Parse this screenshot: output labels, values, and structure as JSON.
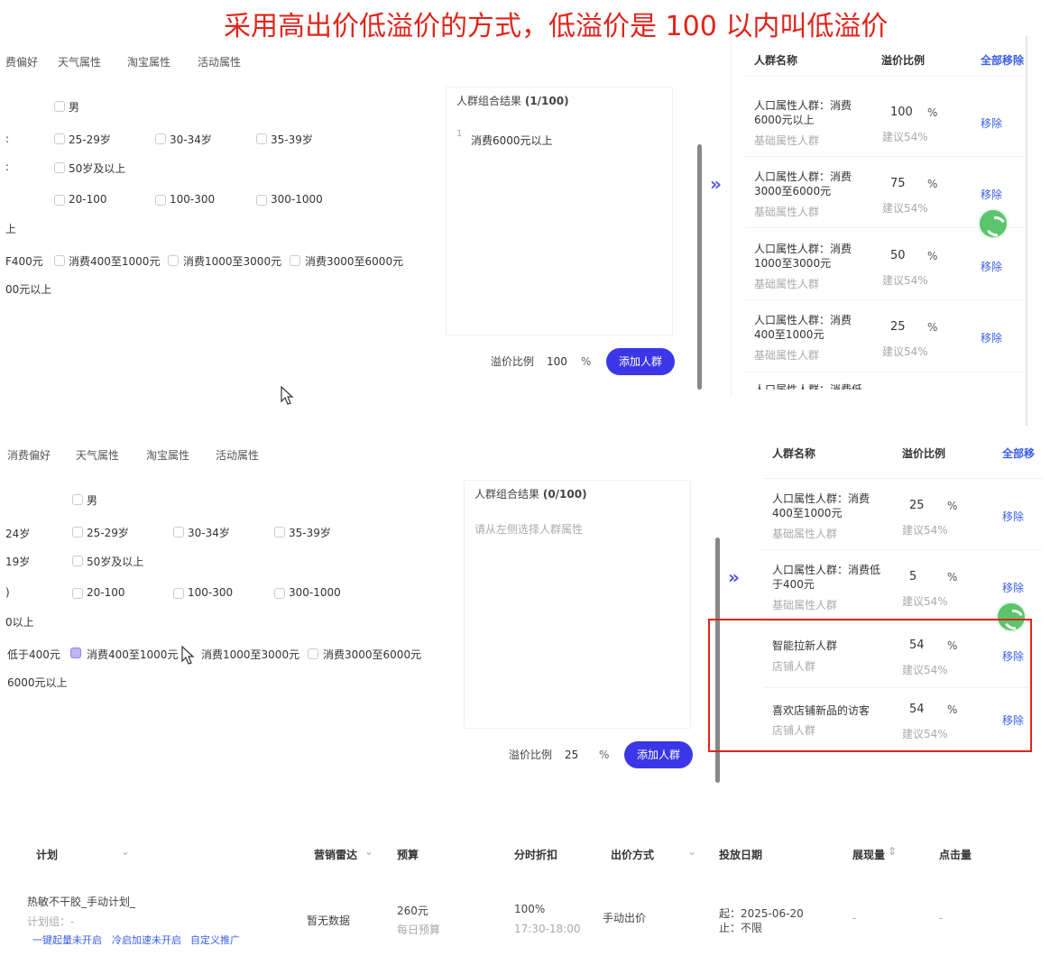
{
  "banner": "采用高出价低溢价的方式，低溢价是 100 以内叫低溢价",
  "panel1": {
    "tabs": [
      "费偏好",
      "天气属性",
      "淘宝属性",
      "活动属性"
    ],
    "options": {
      "gender": "男",
      "age_row_prefix": ":",
      "age1": "25-29岁",
      "age2": "30-34岁",
      "age3": "35-39岁",
      "age_row2_prefix": ":",
      "age4": "50岁及以上",
      "price1": "20-100",
      "price2": "100-300",
      "price3": "300-1000",
      "price_tail": "上",
      "spend_prefix": "F400元",
      "spend1": "消费400至1000元",
      "spend2": "消费1000至3000元",
      "spend3": "消费3000至6000元",
      "spend_tail": "00元以上"
    },
    "result_title": "人群组合结果",
    "result_count": "(1/100)",
    "result_item_index": "1",
    "result_item": "消费6000元以上",
    "premium_label": "溢价比例",
    "premium_value": "100",
    "premium_unit": "%",
    "add_button": "添加人群",
    "table": {
      "col_name": "人群名称",
      "col_ratio": "溢价比例",
      "remove_all": "全部移除",
      "rows": [
        {
          "name": "人口属性人群：消费6000元以上",
          "type": "基础属性人群",
          "value": "100",
          "pct": "%",
          "suggest": "建议54%",
          "remove": "移除"
        },
        {
          "name": "人口属性人群：消费3000至6000元",
          "type": "基础属性人群",
          "value": "75",
          "pct": "%",
          "suggest": "建议54%",
          "remove": "移除"
        },
        {
          "name": "人口属性人群：消费1000至3000元",
          "type": "基础属性人群",
          "value": "50",
          "pct": "%",
          "suggest": "建议54%",
          "remove": "移除"
        },
        {
          "name": "人口属性人群：消费400至1000元",
          "type": "基础属性人群",
          "value": "25",
          "pct": "%",
          "suggest": "建议54%",
          "remove": "移除"
        }
      ],
      "cut_text": "人口属性人群：消费低"
    }
  },
  "panel2": {
    "tabs": [
      "消费偏好",
      "天气属性",
      "淘宝属性",
      "活动属性"
    ],
    "options": {
      "gender": "男",
      "age_row_prefix": "24岁",
      "age1": "25-29岁",
      "age2": "30-34岁",
      "age3": "35-39岁",
      "age_row2_prefix": "19岁",
      "age4": "50岁及以上",
      "price_prefix": ")",
      "price1": "20-100",
      "price2": "100-300",
      "price3": "300-1000",
      "price_tail": "0以上",
      "spend_prefix": "低于400元",
      "spend1": "消费400至1000元",
      "spend2": "消费1000至3000元",
      "spend3": "消费3000至6000元",
      "spend_tail": "6000元以上"
    },
    "result_title": "人群组合结果",
    "result_count": "(0/100)",
    "result_placeholder": "请从左侧选择人群属性",
    "premium_label": "溢价比例",
    "premium_value": "25",
    "premium_unit": "%",
    "add_button": "添加人群",
    "table": {
      "col_name": "人群名称",
      "col_ratio": "溢价比例",
      "remove_all": "全部移",
      "rows": [
        {
          "name": "人口属性人群：消费400至1000元",
          "type": "基础属性人群",
          "value": "25",
          "pct": "%",
          "suggest": "建议54%",
          "remove": "移除"
        },
        {
          "name": "人口属性人群：消费低于400元",
          "type": "基础属性人群",
          "value": "5",
          "pct": "%",
          "suggest": "建议54%",
          "remove": "移除"
        },
        {
          "name": "智能拉新人群",
          "type": "店铺人群",
          "value": "54",
          "pct": "%",
          "suggest": "建议54%",
          "remove": "移除"
        },
        {
          "name": "喜欢店铺新品的访客",
          "type": "店铺人群",
          "value": "54",
          "pct": "%",
          "suggest": "建议54%",
          "remove": "移除"
        }
      ]
    }
  },
  "plans": {
    "headers": [
      "计划",
      "营销雷达",
      "预算",
      "分时折扣",
      "出价方式",
      "投放日期",
      "展现量",
      "点击量"
    ],
    "row": {
      "name": "热敏不干胶_手动计划_",
      "group": "计划组：-",
      "links": [
        "一键起量未开启",
        "冷启加速未开启",
        "自定义推广"
      ],
      "radar": "暂无数据",
      "budget": "260元",
      "budget_sub": "每日预算",
      "discount": "100%",
      "discount_sub": "17:30-18:00",
      "bid": "手动出价",
      "date_start": "起：2025-06-20",
      "date_end": "止：不限",
      "impressions": "-",
      "clicks": "-"
    }
  },
  "icons": {
    "chevron": "double-chevron-right-icon",
    "logo": "green-circle-logo-icon",
    "cursor": "mouse-pointer-icon"
  },
  "colors": {
    "accent": "#3b37e8",
    "banner": "#e0241c",
    "link": "#3b5ee8",
    "highlight_box": "#e0241c"
  }
}
